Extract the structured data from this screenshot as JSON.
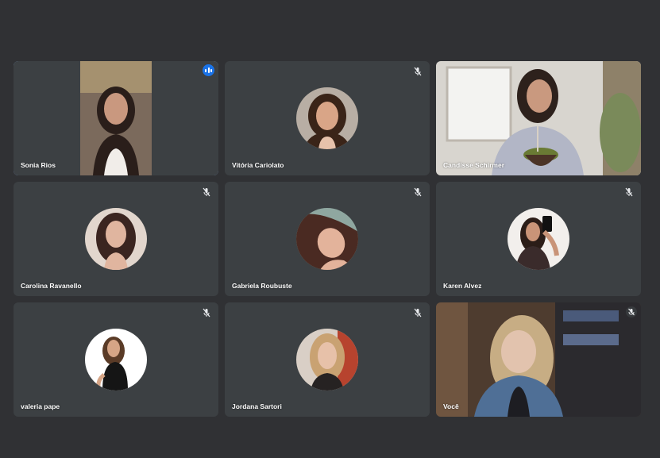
{
  "meeting": {
    "participants": [
      {
        "name": "Sonia Rios",
        "state": "speaking",
        "view": "video"
      },
      {
        "name": "Vitória Cariolato",
        "state": "muted",
        "view": "avatar"
      },
      {
        "name": "Candisse Schirmer",
        "state": "unmuted",
        "view": "video"
      },
      {
        "name": "Carolina Ravanello",
        "state": "muted",
        "view": "avatar"
      },
      {
        "name": "Gabriela Roubuste",
        "state": "muted",
        "view": "avatar"
      },
      {
        "name": "Karen Alvez",
        "state": "muted",
        "view": "avatar"
      },
      {
        "name": "valeria pape",
        "state": "muted",
        "view": "avatar"
      },
      {
        "name": "Jordana Sartori",
        "state": "muted",
        "view": "avatar"
      },
      {
        "name": "Você",
        "state": "muted",
        "view": "video"
      }
    ]
  },
  "colors": {
    "background": "#303134",
    "tile": "#3c4043",
    "active_border": "#8ab4f8",
    "speaking_badge": "#1a73e8"
  }
}
